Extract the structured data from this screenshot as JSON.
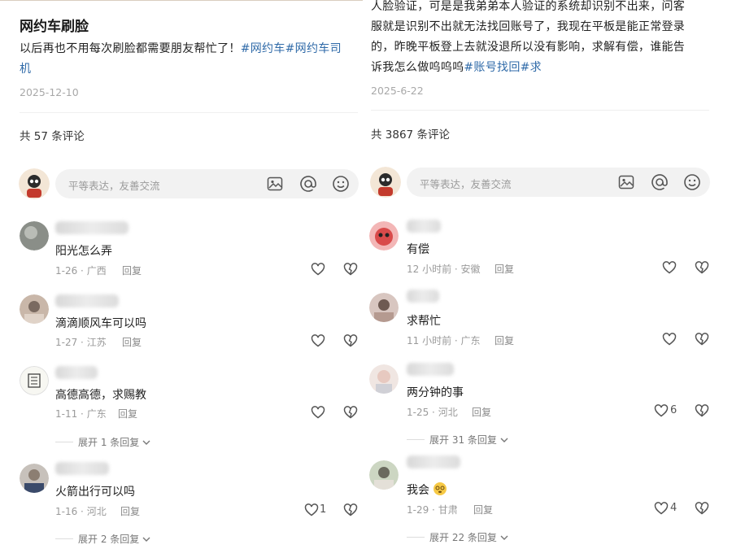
{
  "left": {
    "title": "网约车刷脸",
    "body_plain": "以后再也不用每次刷脸都需要朋友帮忙了！",
    "body_tag1": "#网约车",
    "body_tag2": "#网约车司",
    "body_tag2_cont": "机",
    "date": "2025-12-10",
    "comment_count": "共 57 条评论",
    "input_placeholder": "平等表达，友善交流",
    "comments": [
      {
        "text": "阳光怎么弄",
        "time": "1-26",
        "loc": "广西",
        "reply": "回复",
        "likes": ""
      },
      {
        "text": "滴滴顺风车可以吗",
        "time": "1-27",
        "loc": "江苏",
        "reply": "回复",
        "likes": ""
      },
      {
        "text": "高德高德，求赐教",
        "time": "1-11",
        "loc": "广东",
        "reply": "回复",
        "likes": "",
        "expand": "展开 1 条回复"
      },
      {
        "text": "火箭出行可以吗",
        "time": "1-16",
        "loc": "河北",
        "reply": "回复",
        "likes": "1",
        "expand": "展开 2 条回复"
      }
    ]
  },
  "right": {
    "body_line1": "人脸验证，可是是我弟弟本人验证的系统却识别不出来，问客",
    "body_line2": "服就是识别不出就无法找回账号了，我现在平板是能正常登录",
    "body_line3": "的，昨晚平板登上去就没退所以没有影响，求解有偿，谁能告",
    "body_line4_plain": "诉我怎么做呜呜呜",
    "body_tag1": "#账号找回",
    "body_tag2": "#求",
    "date": "2025-6-22",
    "comment_count": "共 3867 条评论",
    "input_placeholder": "平等表达，友善交流",
    "comments": [
      {
        "text": "有偿",
        "time": "12 小时前",
        "loc": "安徽",
        "reply": "回复",
        "likes": ""
      },
      {
        "text": "求帮忙",
        "time": "11 小时前",
        "loc": "广东",
        "reply": "回复",
        "likes": ""
      },
      {
        "text": "两分钟的事",
        "time": "1-25",
        "loc": "河北",
        "reply": "回复",
        "likes": "6",
        "expand": "展开 31 条回复"
      },
      {
        "text": "我会",
        "time": "1-29",
        "loc": "甘肃",
        "reply": "回复",
        "likes": "4",
        "expand": "展开 22 条回复"
      }
    ]
  },
  "icons": [
    "image-icon",
    "at-icon",
    "emoji-icon",
    "heart-icon",
    "broken-heart-icon",
    "chevron-down-icon"
  ],
  "colors": {
    "tag": "#2f6aa8",
    "meta": "#9a9a9a",
    "input_bg": "#f2f2f2"
  }
}
